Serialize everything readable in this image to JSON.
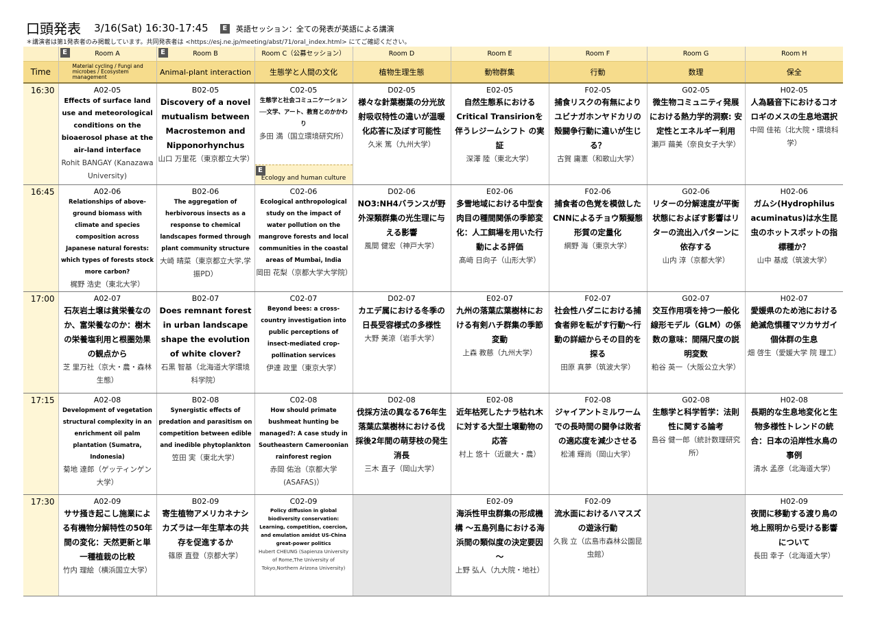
{
  "header": {
    "title": "口頭発表",
    "date": "3/16(Sat) 16:30-17:45",
    "english_badge": "E",
    "english_note": "英語セッション：全ての発表が英語による講演",
    "note": "＊講演者は第1発表者のみ掲載しています。共同発表者は <https://esj.ne.jp/meeting/abst/71/oral_index.html> にてご確認ください。"
  },
  "time_header": "Time",
  "rooms": [
    {
      "name": "Room A",
      "field": "Material cycling / Fungi and microbes / Ecosystem management",
      "english": true
    },
    {
      "name": "Room B",
      "field": "Animal-plant interaction",
      "english": true
    },
    {
      "name": "Room C（公募セッション）",
      "field": "生態学と人間の文化",
      "english": false
    },
    {
      "name": "Room D",
      "field": "植物生理生態",
      "english": false
    },
    {
      "name": "Room E",
      "field": "動物群集",
      "english": false
    },
    {
      "name": "Room F",
      "field": "行動",
      "english": false
    },
    {
      "name": "Room G",
      "field": "数理",
      "english": false
    },
    {
      "name": "Room H",
      "field": "保全",
      "english": false
    }
  ],
  "eco_note": "Ecology and human culture",
  "slots": [
    {
      "time": "16:30",
      "cells": [
        {
          "code": "A02-05",
          "title": "Effects of surface land use and meteorological conditions on the bioaerosol phase at the air-land interface",
          "author": "Rohit BANGAY (Kanazawa University)",
          "style": "en"
        },
        {
          "code": "B02-05",
          "title": "Discovery of a novel mutualism between Macrostemon and Nipponorhynchus",
          "author": "山口 万里花（東京都立大学）",
          "style": ""
        },
        {
          "code": "C02-05",
          "title": "生態学と社会コミュニケーション──文学、アート、教育とのかかわり",
          "author": "多田 満（国立環境研究所）",
          "style": "sm"
        },
        {
          "code": "D02-05",
          "title": "様々な針葉樹葉の分光放射吸収特性の違いが温暖化応答に及ぼす可能性",
          "author": "久米 篤（九州大学）",
          "style": ""
        },
        {
          "code": "E02-05",
          "title": "自然生態系における Critical Transirionを伴うレジームシフト の実証",
          "author": "深澤 陸（東北大学）",
          "style": ""
        },
        {
          "code": "F02-05",
          "title": "捕食リスクの有無によりユビナガホンヤドカリの殻闘争行動に違いが生じる？",
          "author": "古賀 庸憲（和歌山大学）",
          "style": ""
        },
        {
          "code": "G02-05",
          "title": "微生物コミュニティ発展における熱力学的洞察: 安定性とエネルギー利用",
          "author": "瀬戸 繭美（奈良女子大学）",
          "style": ""
        },
        {
          "code": "H02-05",
          "title": "人為騒音下におけるコオロギのメスの生息地選択",
          "author": "中岡 佳祐（北大院・環境科学）",
          "style": ""
        }
      ]
    },
    {
      "time": "16:45",
      "cells": [
        {
          "code": "A02-06",
          "title": "Relationships of above-ground biomass with climate and species composition across Japanese natural forests: which types of forests stock more carbon?",
          "author": "梶野 浩史（東北大学）",
          "style": "sm"
        },
        {
          "code": "B02-06",
          "title": "The aggregation of herbivorous insects as a response to chemical landscapes formed through plant community structure",
          "author": "大崎 晴菜（東京都立大学,学振PD）",
          "style": "sm"
        },
        {
          "code": "C02-06",
          "title": "Ecological anthropological study on the impact of water pollution on the mangrove forests and local communities in the coastal areas of Mumbai, India",
          "author": "岡田 花梨（京都大学大学院）",
          "style": "sm"
        },
        {
          "code": "D02-06",
          "title": "NO3:NH4バランスが野外深類群集の光生理に与える影響",
          "author": "風間 健宏（神戸大学）",
          "style": ""
        },
        {
          "code": "E02-06",
          "title": "多雪地域における中型食肉目の種間関係の季節変化：人工餌場を用いた行動による評価",
          "author": "髙﨑 日向子（山形大学）",
          "style": ""
        },
        {
          "code": "F02-06",
          "title": "捕食者の色覚を模倣したCNNによるチョウ類擬態形質の定量化",
          "author": "綱野 海（東京大学）",
          "style": ""
        },
        {
          "code": "G02-06",
          "title": "リターの分解速度が平衡状態におよぼす影響はリターの流出入パターンに依存する",
          "author": "山内 淳（京都大学）",
          "style": ""
        },
        {
          "code": "H02-06",
          "title": "ガムシ(Hydrophilus acuminatus)は水生昆虫のホットスポットの指標種か？",
          "author": "山中 基成（筑波大学）",
          "style": ""
        }
      ]
    },
    {
      "time": "17:00",
      "cells": [
        {
          "code": "A02-07",
          "title": "石灰岩土壌は貧栄養なのか、富栄養なのか：樹木の栄養塩利用と根圏効果の観点から",
          "author": "芝 里万社（京大・農・森林生態）",
          "style": ""
        },
        {
          "code": "B02-07",
          "title": "Does remnant forest in urban landscape shape the evolution of white clover?",
          "author": "石黒 智基（北海道大学環境科学院）",
          "style": ""
        },
        {
          "code": "C02-07",
          "title": "Beyond bees: a cross-country investigation into public perceptions of insect-mediated crop-pollination services",
          "author": "伊達 政里（東京大学）",
          "style": "sm"
        },
        {
          "code": "D02-07",
          "title": "カエデ属における冬季の日長受容様式の多様性",
          "author": "大野 美涼（岩手大学）",
          "style": ""
        },
        {
          "code": "E02-07",
          "title": "九州の落葉広葉樹林における有剣ハチ群集の季節変動",
          "author": "上森 教慈（九州大学）",
          "style": ""
        },
        {
          "code": "F02-07",
          "title": "社会性ハダニにおける捕食者卵を転がす行動～行動の詳細からその目的を探る",
          "author": "田原 真夢（筑波大学）",
          "style": ""
        },
        {
          "code": "G02-07",
          "title": "交互作用項を持つ一般化線形モデル（GLM）の係数の意味：間隔尺度の説明変数",
          "author": "粕谷 英一（大阪公立大学）",
          "style": ""
        },
        {
          "code": "H02-07",
          "title": "愛媛県のため池における絶滅危惧種マツカサガイ個体群の生息",
          "author": "畑 啓生（愛媛大学 院 理工）",
          "style": ""
        }
      ]
    },
    {
      "time": "17:15",
      "cells": [
        {
          "code": "A02-08",
          "title": "Development of vegetation structural complexity in an enrichment oil palm plantation (Sumatra, Indonesia)",
          "author": "菊地 達郎（ゲッティンゲン大学）",
          "style": "sm"
        },
        {
          "code": "B02-08",
          "title": "Synergistic effects of predation and parasitism on competition between edible and inedible phytoplankton",
          "author": "笠田 実（東北大学）",
          "style": "sm"
        },
        {
          "code": "C02-08",
          "title": "How should primate bushmeat hunting be managed?: A case study in Southeastern Cameroonian rainforest region",
          "author": "赤岡 佑治（京都大学 (ASAFAS)）",
          "style": "sm"
        },
        {
          "code": "D02-08",
          "title": "伐採方法の異なる76年生落葉広葉樹林における伐採後2年間の萌芽枝の発生消長",
          "author": "三木 直子（岡山大学）",
          "style": ""
        },
        {
          "code": "E02-08",
          "title": "近年枯死したナラ枯れ木に対する大型土壌動物の応答",
          "author": "村上 悠十（近畿大・農）",
          "style": ""
        },
        {
          "code": "F02-08",
          "title": "ジャイアントミルワームでの長時間の闘争は敗者の適応度を減少させる",
          "author": "松浦 輝尚（岡山大学）",
          "style": ""
        },
        {
          "code": "G02-08",
          "title": "生態学と科学哲学：法則性に関する論考",
          "author": "島谷 健一郎（統計数理研究所）",
          "style": ""
        },
        {
          "code": "H02-08",
          "title": "長期的な生息地変化と生物多様性トレンドの統合：日本の沿岸性水鳥の事例",
          "author": "清水 孟彦（北海道大学）",
          "style": ""
        }
      ]
    },
    {
      "time": "17:30",
      "cells": [
        {
          "code": "A02-09",
          "title": "ササ掻き起こし施業による有機物分解特性の50年間の変化：天然更新と単一種植栽の比較",
          "author": "竹内 理絵（横浜国立大学）",
          "style": ""
        },
        {
          "code": "B02-09",
          "title": "寄生植物アメリカネナシカズラは一年生草本の共存を促進するか",
          "author": "篠原 直登（京都大学）",
          "style": ""
        },
        {
          "code": "C02-09",
          "title": "Policy diffusion in global biodiversity conservation: Learning, competition, coercion, and emulation amidst US-China great-power politics",
          "author": "Hubert CHEUNG (Sapienza University of Rome,The University of Tokyo,Northern Arizona University)",
          "style": "xs"
        },
        {
          "code": "",
          "title": "",
          "author": "",
          "style": "empty"
        },
        {
          "code": "E02-09",
          "title": "海浜性甲虫群集の形成機構 ～五島列島における海浜間の類似度の決定要因～",
          "author": "上野 弘人（九大院・地社）",
          "style": ""
        },
        {
          "code": "F02-09",
          "title": "流水面におけるハマスズの遊泳行動",
          "author": "久我 立（広島市森林公園昆虫館）",
          "style": ""
        },
        {
          "code": "",
          "title": "",
          "author": "",
          "style": "empty"
        },
        {
          "code": "H02-09",
          "title": "夜間に移動する渡り鳥の地上照明から受ける影響について",
          "author": "長田 幸子（北海道大学）",
          "style": ""
        }
      ]
    }
  ]
}
